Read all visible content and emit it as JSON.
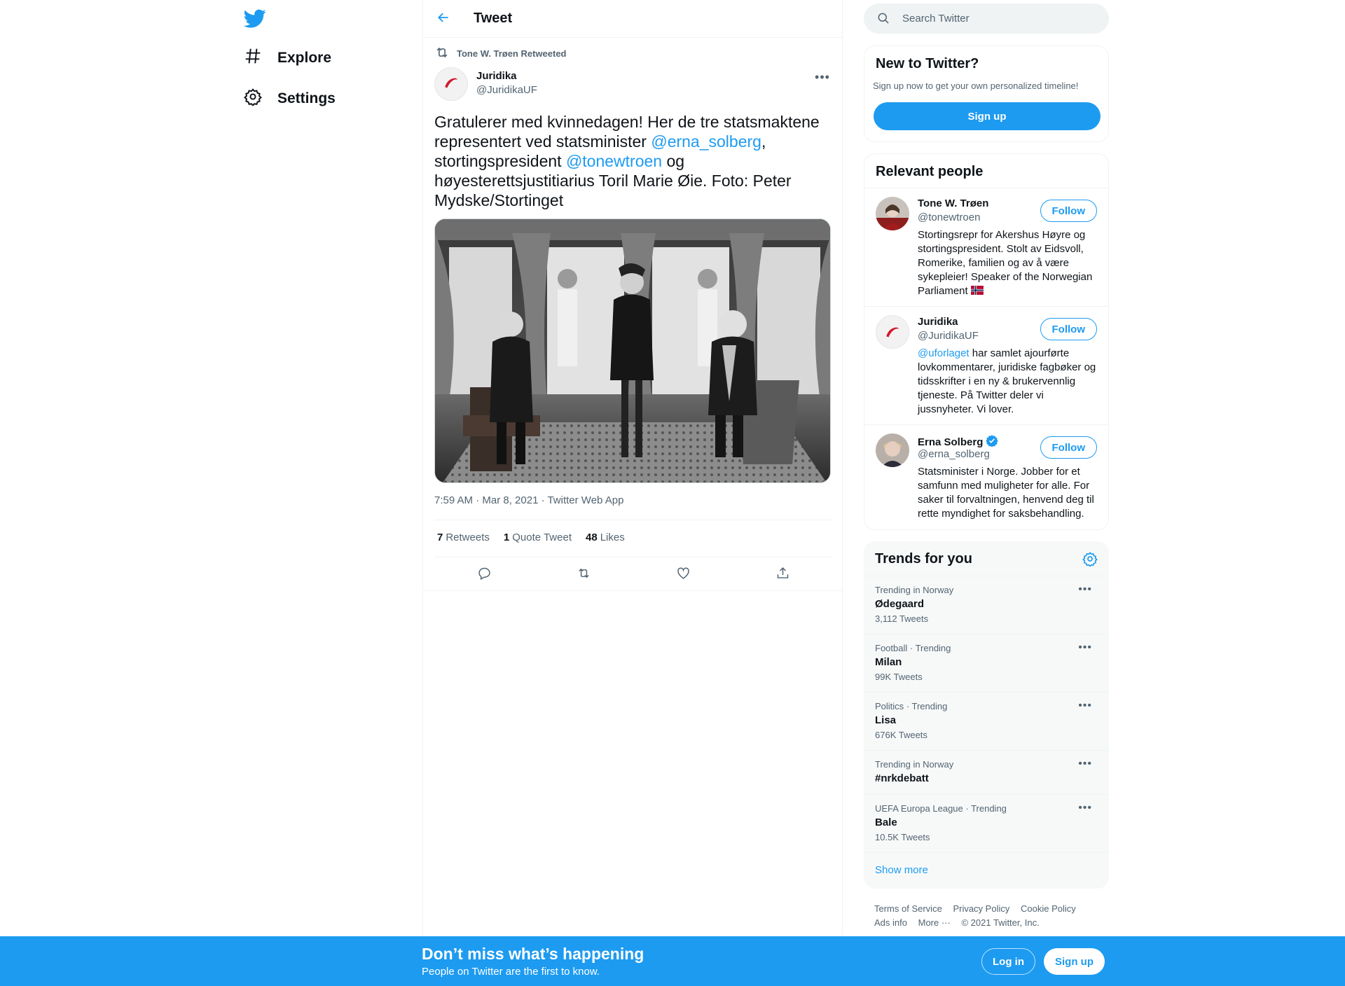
{
  "brand": {
    "accent": "#1d9bf0",
    "logo_icon": "twitter-bird-icon"
  },
  "nav": {
    "items": [
      {
        "label": "Explore",
        "icon": "hashtag-icon"
      },
      {
        "label": "Settings",
        "icon": "gear-icon"
      }
    ]
  },
  "header": {
    "title": "Tweet",
    "back_icon": "arrow-left-icon"
  },
  "tweet": {
    "retweeted_by": "Tone W. Trøen Retweeted",
    "author_name": "Juridika",
    "author_handle": "@JuridikaUF",
    "text_parts": [
      "Gratulerer med kvinnedagen! Her de tre statsmaktene representert ved statsminister ",
      "@erna_solberg",
      ", stortingspresident ",
      "@tonewtroen",
      " og høyesterettsjustitiarius Toril Marie Øie. Foto: Peter Mydske/Stortinget"
    ],
    "meta": "7:59 AM · Mar 8, 2021 · Twitter Web App",
    "stats": {
      "retweets_count": "7",
      "retweets_label": "Retweets",
      "quotes_count": "1",
      "quotes_label": "Quote Tweet",
      "likes_count": "48",
      "likes_label": "Likes"
    }
  },
  "search": {
    "placeholder": "Search Twitter"
  },
  "new_to_twitter": {
    "title": "New to Twitter?",
    "subtitle": "Sign up now to get your own personalized timeline!",
    "button": "Sign up"
  },
  "relevant_people": {
    "title": "Relevant people",
    "follow_label": "Follow",
    "people": [
      {
        "name": "Tone W. Trøen",
        "handle": "@tonewtroen",
        "bio": "Stortingsrepr for Akershus Høyre og stortingspresident. Stolt av Eidsvoll, Romerike, familien og av å være sykepleier! Speaker of the Norwegian Parliament",
        "verified": false
      },
      {
        "name": "Juridika",
        "handle": "@JuridikaUF",
        "bio_mention": "@uforlaget",
        "bio": " har samlet ajourførte lovkommentarer, juridiske fagbøker og tidsskrifter i en ny & brukervennlig tjeneste. På Twitter deler vi jussnyheter. Vi lover.",
        "verified": false
      },
      {
        "name": "Erna Solberg",
        "handle": "@erna_solberg",
        "bio": "Statsminister i Norge. Jobber for et samfunn med muligheter for alle. For saker til forvaltningen, henvend deg til rette myndighet for saksbehandling.",
        "verified": true
      }
    ]
  },
  "trends": {
    "title": "Trends for you",
    "items": [
      {
        "context": "Trending in Norway",
        "name": "Ødegaard",
        "count": "3,112 Tweets"
      },
      {
        "context": "Football · Trending",
        "name": "Milan",
        "count": "99K Tweets"
      },
      {
        "context": "Politics · Trending",
        "name": "Lisa",
        "count": "676K Tweets"
      },
      {
        "context": "Trending in Norway",
        "name": "#nrkdebatt",
        "count": ""
      },
      {
        "context": "UEFA Europa League · Trending",
        "name": "Bale",
        "count": "10.5K Tweets"
      }
    ],
    "show_more": "Show more"
  },
  "footer": {
    "terms": "Terms of Service",
    "privacy": "Privacy Policy",
    "cookie": "Cookie Policy",
    "ads": "Ads info",
    "more": "More ···",
    "copyright": "© 2021 Twitter, Inc."
  },
  "bottom_bar": {
    "title": "Don’t miss what’s happening",
    "subtitle": "People on Twitter are the first to know.",
    "login": "Log in",
    "signup": "Sign up"
  }
}
